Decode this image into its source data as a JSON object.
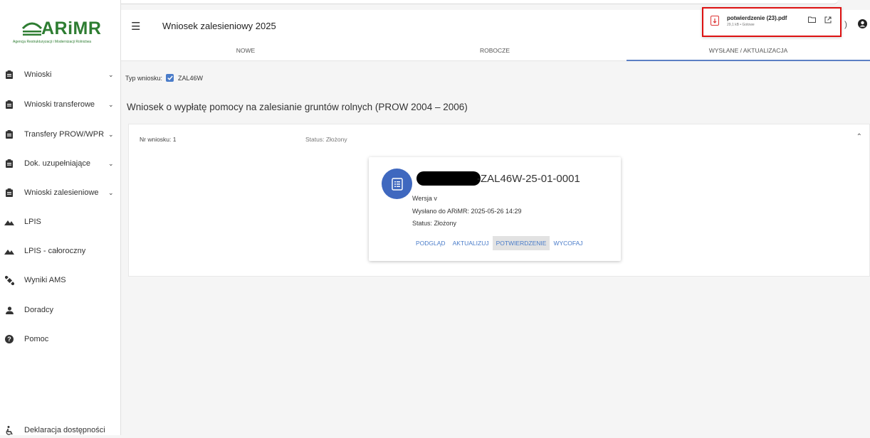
{
  "colors": {
    "accent": "#4a7cc9",
    "brand": "#2e7d32",
    "avatar": "#3f68bf",
    "highlight_box": "#dd1111"
  },
  "logo": {
    "text": "ARiMR",
    "subtitle": "Agencja Restrukturyzacji i Modernizacji Rolnictwa"
  },
  "sidebar": {
    "items": [
      {
        "label": "Wnioski",
        "icon": "clipboard-icon",
        "chevron": "⌄"
      },
      {
        "label": "Wnioski transferowe",
        "icon": "clipboard-icon",
        "chevron": "⌄"
      },
      {
        "label": "Transfery PROW/WPR",
        "icon": "clipboard-icon",
        "chevron": "⌄"
      },
      {
        "label": "Dok. uzupełniające",
        "icon": "clipboard-icon",
        "chevron": "⌄"
      },
      {
        "label": "Wnioski zalesieniowe",
        "icon": "clipboard-icon",
        "chevron": "⌄"
      },
      {
        "label": "LPIS",
        "icon": "mountain-icon"
      },
      {
        "label": "LPIS - całoroczny",
        "icon": "mountain-icon"
      },
      {
        "label": "Wyniki AMS",
        "icon": "satellite-icon"
      },
      {
        "label": "Doradcy",
        "icon": "person-icon"
      },
      {
        "label": "Pomoc",
        "icon": "help-icon"
      }
    ],
    "footer": {
      "label": "Deklaracja dostępności",
      "icon": "accessibility-icon"
    }
  },
  "header": {
    "title": "Wniosek zalesieniowy 2025"
  },
  "tabs": [
    "NOWE",
    "ROBOCZE",
    "WYSŁANE / AKTUALIZACJA"
  ],
  "filter": {
    "label": "Typ wniosku:",
    "value": "ZAL46W"
  },
  "section_title": "Wniosek o wypłatę pomocy na zalesianie gruntów rolnych (PROW 2004 – 2006)",
  "panel": {
    "nr": "Nr wniosku: 1",
    "status": "Status: Złożony",
    "card": {
      "id_suffix": "-ZAL46W-25-01-0001",
      "version": "Wersja v",
      "sent": "Wysłano do ARiMR: 2025-05-26 14:29",
      "status": "Status: Złożony",
      "actions": [
        "PODGLĄD",
        "AKTUALIZUJ",
        "POTWIERDZENIE",
        "WYCOFAJ"
      ]
    }
  },
  "download": {
    "filename": "potwierdzenie (23).pdf",
    "meta": "29,1 kB • Gotowe"
  }
}
